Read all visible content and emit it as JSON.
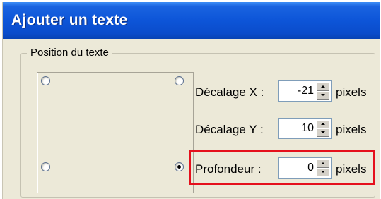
{
  "window": {
    "title": "Ajouter un texte"
  },
  "group": {
    "legend": "Position du texte"
  },
  "position": {
    "selected": "bottom-right"
  },
  "fields": {
    "offset_x": {
      "label": "Décalage X :",
      "value": "-21",
      "unit": "pixels"
    },
    "offset_y": {
      "label": "Décalage Y :",
      "value": "10",
      "unit": "pixels"
    },
    "depth": {
      "label": "Profondeur :",
      "value": "0",
      "unit": "pixels"
    }
  },
  "colors": {
    "highlight": "#e5101c",
    "titlebar": "#0d55d8"
  }
}
